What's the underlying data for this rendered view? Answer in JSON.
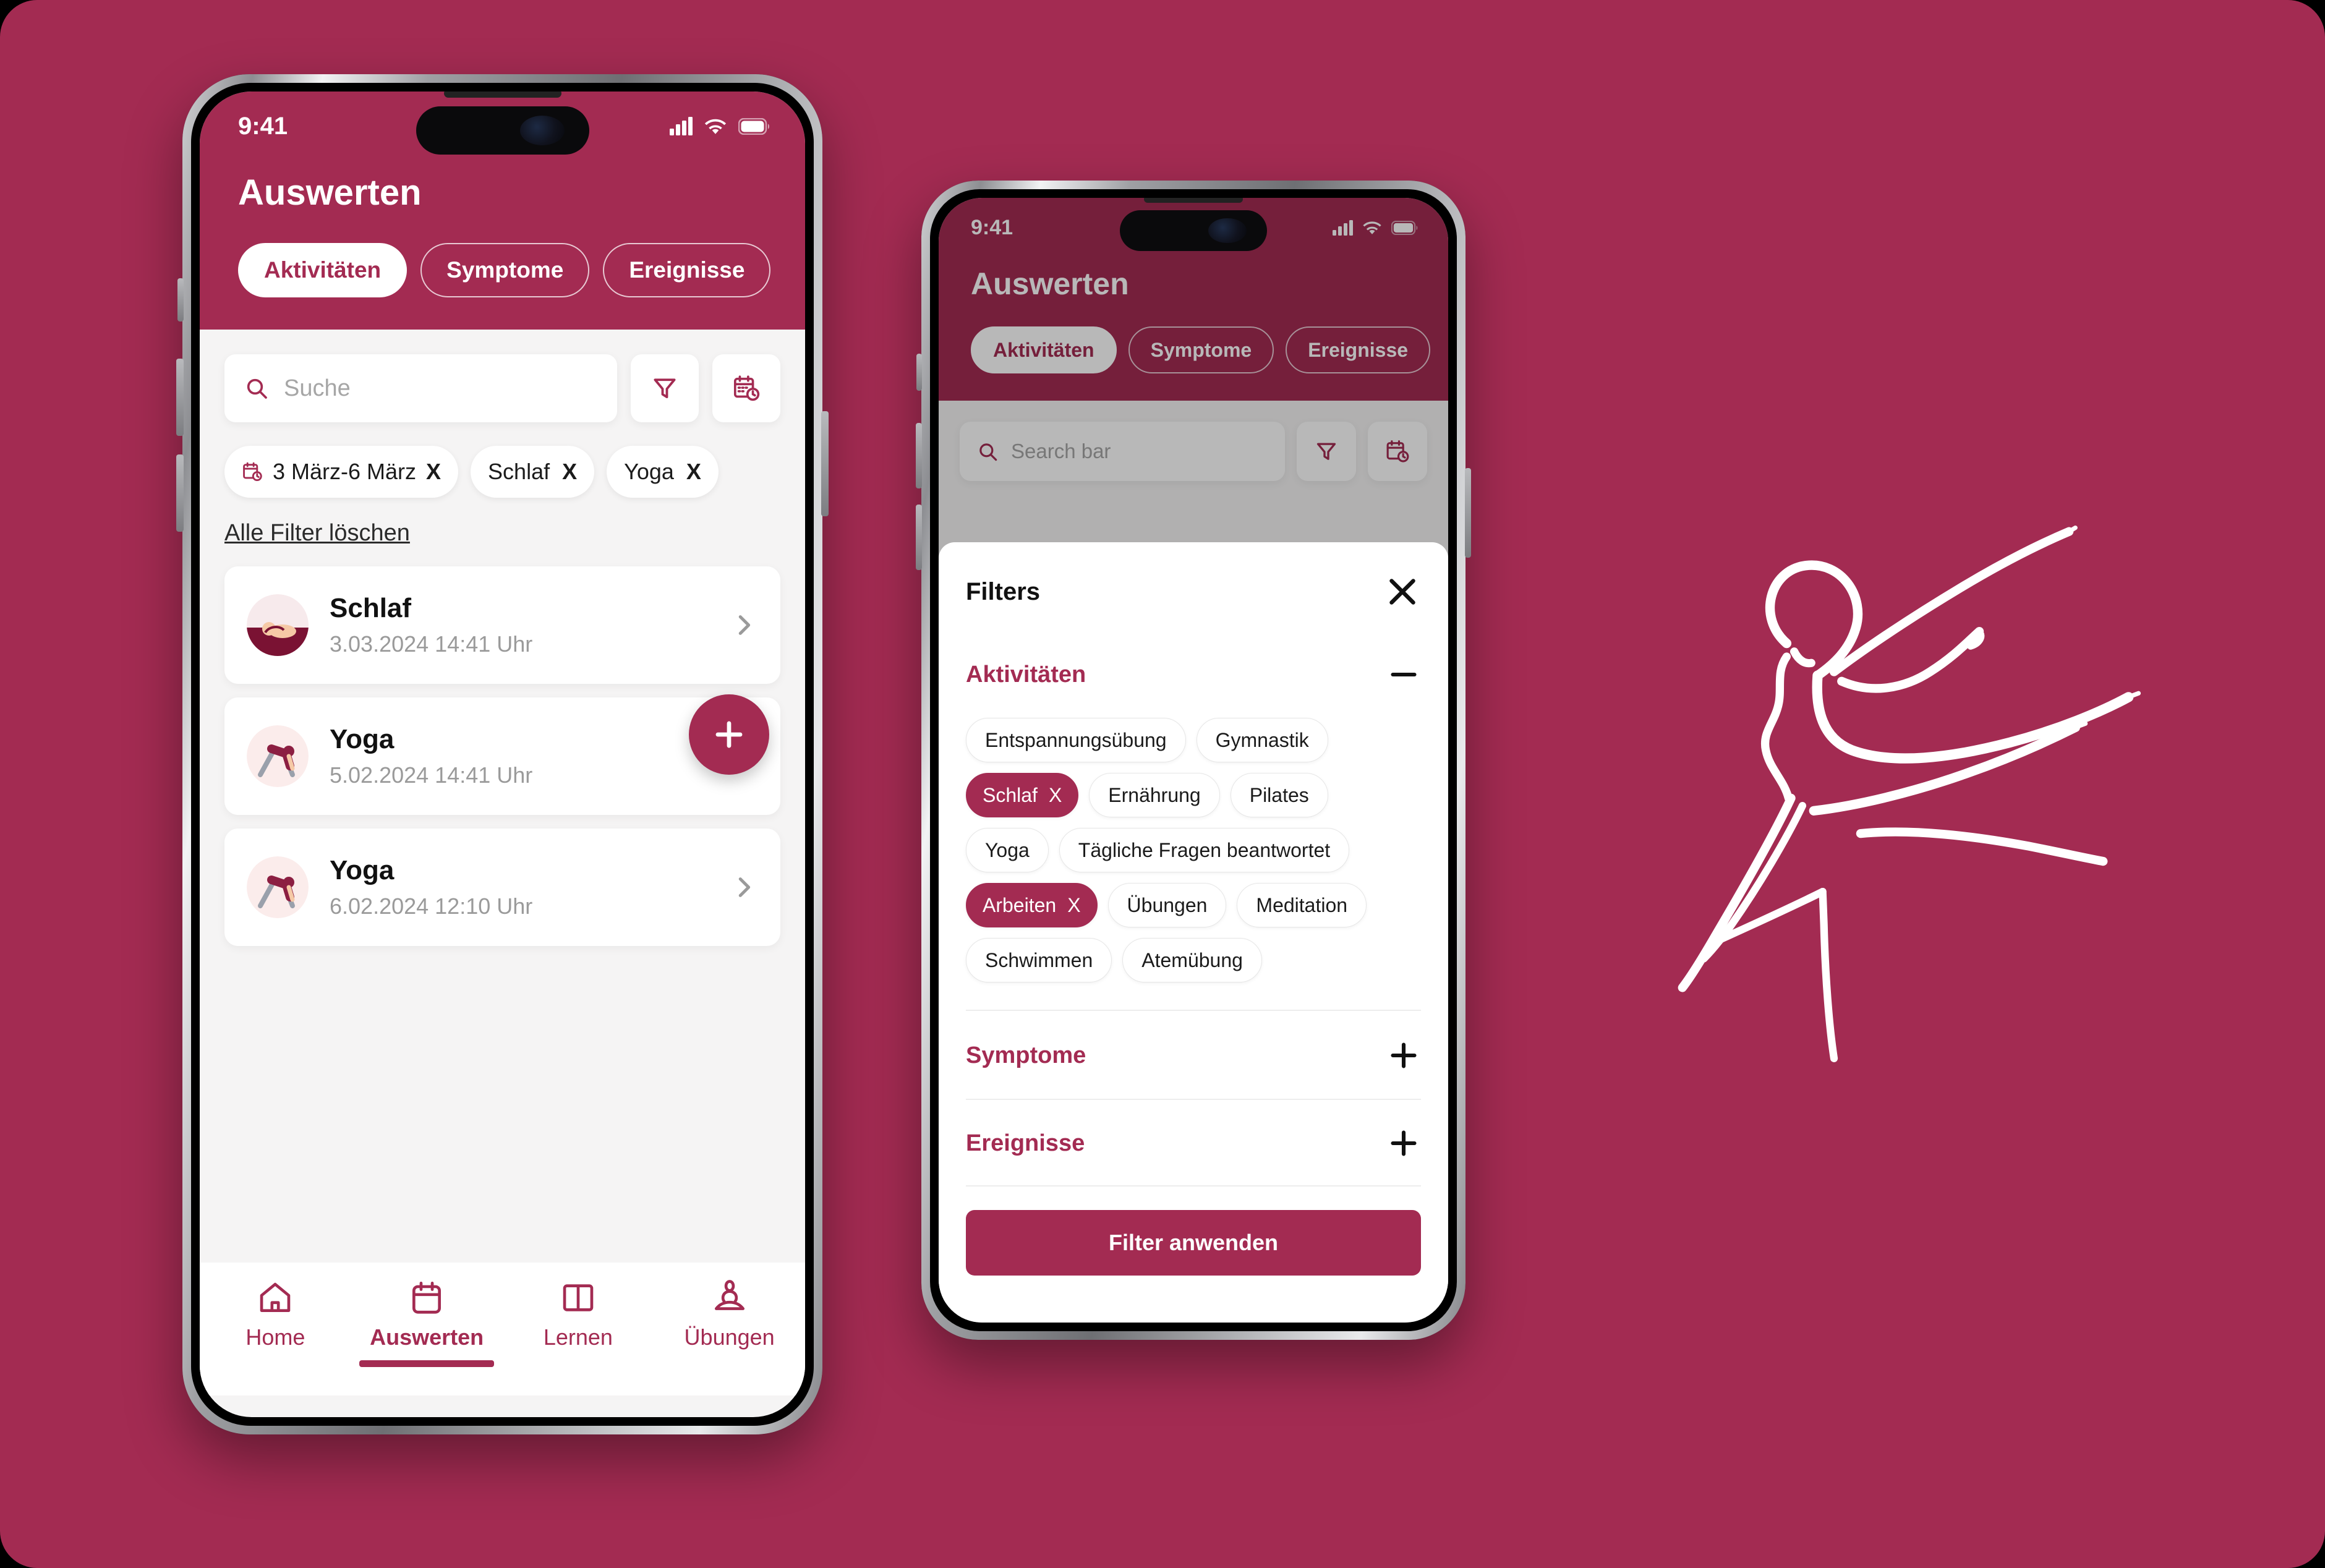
{
  "theme": {
    "brand": "#A32B52",
    "canvas_bg": "#A32B52",
    "body_bg": "#f5f4f4",
    "card_bg": "#ffffff",
    "muted_text": "#9a9a9a"
  },
  "phone1": {
    "status": {
      "time": "9:41",
      "signal_icon": "cellular-bars-icon",
      "wifi_icon": "wifi-icon",
      "battery_icon": "battery-icon"
    },
    "header": {
      "title": "Auswerten",
      "tabs": [
        {
          "label": "Aktivitäten",
          "active": true
        },
        {
          "label": "Symptome",
          "active": false
        },
        {
          "label": "Ereignisse",
          "active": false
        }
      ]
    },
    "search": {
      "placeholder": "Suche",
      "value": "",
      "search_icon": "search-icon"
    },
    "toolbar": {
      "filter_icon": "filter-funnel-icon",
      "date_icon": "calendar-clock-icon"
    },
    "active_filters": [
      {
        "label": "3 März-6 März",
        "icon": "calendar-clock-icon",
        "remove": "X"
      },
      {
        "label": "Schlaf",
        "icon": "",
        "remove": "X"
      },
      {
        "label": "Yoga",
        "icon": "",
        "remove": "X"
      }
    ],
    "clear_all_label": "Alle Filter löschen",
    "list": [
      {
        "title": "Schlaf",
        "subtitle": "3.03.2024 14:41 Uhr",
        "avatar": "sleeping-person-icon",
        "chevron": "chevron-right-icon"
      },
      {
        "title": "Yoga",
        "subtitle": "5.02.2024 14:41 Uhr",
        "avatar": "yoga-pose-icon",
        "chevron": "chevron-right-icon"
      },
      {
        "title": "Yoga",
        "subtitle": "6.02.2024 12:10 Uhr",
        "avatar": "yoga-pose-icon",
        "chevron": "chevron-right-icon"
      }
    ],
    "fab": {
      "icon": "plus-icon",
      "label": "+"
    },
    "tabbar": [
      {
        "label": "Home",
        "icon": "home-icon",
        "active": false
      },
      {
        "label": "Auswerten",
        "icon": "calendar-icon",
        "active": true
      },
      {
        "label": "Lernen",
        "icon": "book-open-icon",
        "active": false
      },
      {
        "label": "Übungen",
        "icon": "meditation-icon",
        "active": false
      }
    ]
  },
  "phone2": {
    "status": {
      "time": "9:41",
      "signal_icon": "cellular-bars-icon",
      "wifi_icon": "wifi-icon",
      "battery_icon": "battery-icon"
    },
    "header": {
      "title": "Auswerten",
      "tabs": [
        {
          "label": "Aktivitäten",
          "active": true
        },
        {
          "label": "Symptome",
          "active": false
        },
        {
          "label": "Ereignisse",
          "active": false
        }
      ]
    },
    "search": {
      "placeholder": "Search bar",
      "value": "",
      "search_icon": "search-icon"
    },
    "toolbar": {
      "filter_icon": "filter-funnel-icon",
      "date_icon": "calendar-clock-icon"
    },
    "sheet": {
      "title": "Filters",
      "close_icon": "close-x-icon",
      "sections": [
        {
          "title": "Aktivitäten",
          "expanded": true,
          "toggle_icon": "minus-icon",
          "toggle_glyph": "—"
        },
        {
          "title": "Symptome",
          "expanded": false,
          "toggle_icon": "plus-icon",
          "toggle_glyph": "+"
        },
        {
          "title": "Ereignisse",
          "expanded": false,
          "toggle_icon": "plus-icon",
          "toggle_glyph": "+"
        }
      ],
      "activity_chips": [
        {
          "label": "Entspannungsübung",
          "selected": false
        },
        {
          "label": "Gymnastik",
          "selected": false
        },
        {
          "label": "Schlaf",
          "selected": true,
          "remove": "X"
        },
        {
          "label": "Ernährung",
          "selected": false
        },
        {
          "label": "Pilates",
          "selected": false
        },
        {
          "label": "Yoga",
          "selected": false
        },
        {
          "label": "Tägliche Fragen beantwortet",
          "selected": false
        },
        {
          "label": "Arbeiten",
          "selected": true,
          "remove": "X"
        },
        {
          "label": "Übungen",
          "selected": false
        },
        {
          "label": "Meditation",
          "selected": false
        },
        {
          "label": "Schwimmen",
          "selected": false
        },
        {
          "label": "Atemübung",
          "selected": false
        }
      ],
      "apply_label": "Filter anwenden"
    }
  },
  "brand_logo": {
    "name": "dancing-figure-line-art-logo"
  }
}
